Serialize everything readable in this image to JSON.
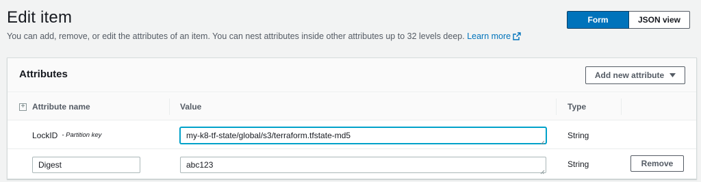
{
  "header": {
    "title": "Edit item",
    "description": "You can add, remove, or edit the attributes of an item. You can nest attributes inside other attributes up to 32 levels deep.",
    "learn_more": "Learn more"
  },
  "view_toggle": {
    "form": "Form",
    "json": "JSON view",
    "selected": "Form"
  },
  "panel": {
    "title": "Attributes",
    "add_button": "Add new attribute"
  },
  "table": {
    "columns": [
      "Attribute name",
      "Value",
      "Type"
    ],
    "rows": [
      {
        "name": "LockID",
        "key_label": "- Partition key",
        "value": "my-k8-tf-state/global/s3/terraform.tfstate-md5",
        "type": "String"
      },
      {
        "name": "Digest",
        "value": "abc123",
        "type": "String",
        "remove_label": "Remove"
      }
    ]
  },
  "colors": {
    "primary": "#0073bb",
    "focus": "#00a1c9",
    "text": "#16191f",
    "muted": "#545b64"
  },
  "icons": [
    "external-link-icon",
    "caret-down-icon",
    "expand-all-icon",
    "resize-handle-icon"
  ]
}
